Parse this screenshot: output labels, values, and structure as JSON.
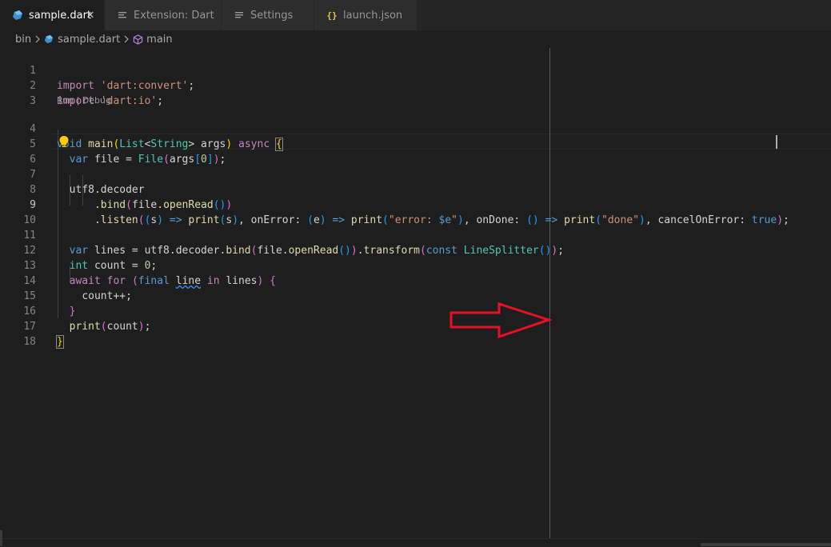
{
  "tabs": [
    {
      "label": "sample.dart",
      "icon": "dart-icon",
      "active": true,
      "close": "✕"
    },
    {
      "label": "Extension: Dart",
      "icon": "preview-icon",
      "active": false
    },
    {
      "label": "Settings",
      "icon": "settings-file-icon",
      "active": false
    },
    {
      "label": "launch.json",
      "icon": "json-braces-icon",
      "active": false,
      "icon_text": "{}"
    }
  ],
  "breadcrumb": {
    "folder": "bin",
    "file": "sample.dart",
    "symbol": "main"
  },
  "codelens": {
    "run": "Run",
    "separator": " | ",
    "debug": "Debug"
  },
  "line_numbers": [
    "1",
    "2",
    "3",
    "4",
    "5",
    "6",
    "7",
    "8",
    "9",
    "10",
    "11",
    "12",
    "13",
    "14",
    "15",
    "16",
    "17",
    "18"
  ],
  "current_line": 9,
  "code": {
    "l1": {
      "kw": "import",
      "sp": " ",
      "str": "'dart:convert'",
      "end": ";"
    },
    "l2": {
      "kw": "import",
      "sp": " ",
      "str": "'dart:io'",
      "end": ";"
    },
    "l4": {
      "void": "void",
      "fn": "main",
      "paren_open": "(",
      "type1": "List",
      "lt": "<",
      "type2": "String",
      "gt": ">",
      "arg": " args",
      "paren_close": ")",
      "async": "async",
      "brace": "{"
    },
    "l5": {
      "var": "var",
      "rest1": " file = ",
      "type": "File",
      "p1": "(",
      "rest2": "args",
      "br1": "[",
      "num": "0",
      "br2": "]",
      "p2": ")",
      "end": ";"
    },
    "l7": {
      "text": "utf8.decoder"
    },
    "l8": {
      "dot": ".",
      "fn": "bind",
      "p1": "(",
      "obj": "file.",
      "fn2": "openRead",
      "p2": "()",
      "p3": ")"
    },
    "l9": {
      "dot": ".",
      "fn": "listen",
      "p1": "(",
      "p2": "(",
      "s": "s",
      "p2c": ")",
      "arrow1": " => ",
      "print1": "print",
      "pp1": "(",
      "s2": "s",
      "pp1c": ")",
      "comma1": ", onError: ",
      "pe": "(",
      "e": "e",
      "pec": ")",
      "arrow2": " => ",
      "print2": "print",
      "pp2": "(",
      "str1a": "\"error: ",
      "interp": "$e",
      "str1b": "\"",
      "pp2c": ")",
      "comma2": ", onDone: ",
      "empty": "()",
      "arrow3": " => ",
      "print3": "print",
      "pp3": "(",
      "str2": "\"done\"",
      "pp3c": ")",
      "comma3": ", cancelOnError: ",
      "bool": "true",
      "p1c": ")",
      "end": ";"
    },
    "l11": {
      "var": "var",
      "rest1": " lines = utf8.decoder.",
      "fn1": "bind",
      "p1": "(",
      "obj": "file.",
      "fn2": "openRead",
      "p2": "()",
      "p1c": ")",
      "dot": ".",
      "fn3": "transform",
      "p3": "(",
      "const": "const",
      "sp": " ",
      "cls": "LineSplitter",
      "p4": "()",
      "p3c": ")",
      "end": ";"
    },
    "l12": {
      "type": "int",
      "rest": " count = ",
      "num": "0",
      "end": ";"
    },
    "l13": {
      "await": "await",
      "sp1": " ",
      "for": "for",
      "sp2": " ",
      "p1": "(",
      "final": "final",
      "sp3": " ",
      "var": "line",
      "sp4": " ",
      "in": "in",
      "rest": " lines",
      "p1c": ")",
      "sp5": " ",
      "brace": "{"
    },
    "l14": {
      "text": "count++;"
    },
    "l15": {
      "brace": "}"
    },
    "l16": {
      "fn": "print",
      "p1": "(",
      "arg": "count",
      "p1c": ")",
      "end": ";"
    },
    "l17": {
      "brace": "}"
    }
  },
  "colors": {
    "background": "#1e1e1e",
    "keyword": "#569cd6",
    "control": "#c586c0",
    "string": "#ce9178",
    "function": "#dcdcaa",
    "type": "#4ec9b0",
    "number": "#b5cea8",
    "annotation_arrow": "#e81123"
  }
}
